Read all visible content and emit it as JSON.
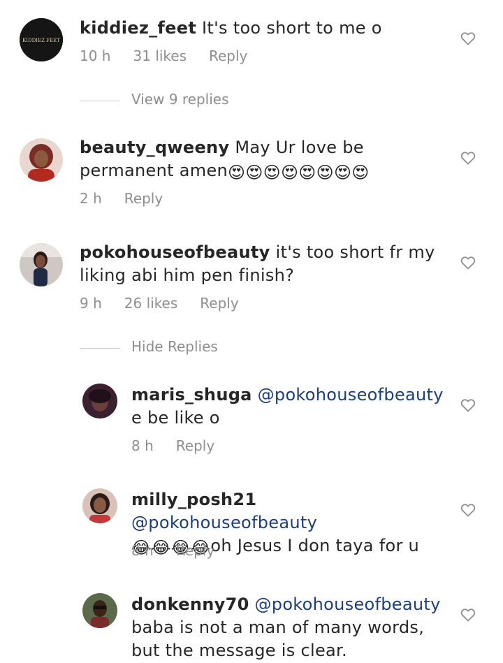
{
  "comments": [
    {
      "username": "kiddiez_feet",
      "text": " It's too short to me o",
      "time": "10 h",
      "likes": "31 likes",
      "reply": "Reply",
      "avatar_text": "KIDDIEZ FEET"
    },
    {
      "username": "beauty_qweeny",
      "text": " May Ur love be permanent amen",
      "emojis": "😍😍😍😍😍😍😍😍",
      "time": "2 h",
      "reply": "Reply"
    },
    {
      "username": "pokohouseofbeauty",
      "text": " it's too short fr my liking abi him pen finish?",
      "time": "9 h",
      "likes": "26 likes",
      "reply": "Reply"
    }
  ],
  "view_replies": "View 9 replies",
  "hide_replies": "Hide Replies",
  "replies": [
    {
      "username": "maris_shuga",
      "mention": " @pokohouseofbeauty",
      "text": " e be like o",
      "time": "8 h",
      "reply": "Reply"
    },
    {
      "username": "milly_posh21",
      "mention": " @pokohouseofbeauty",
      "emojis": "😂😂😂😂",
      "text": "oh Jesus I don taya for u",
      "time": "8 h",
      "reply": "Reply"
    },
    {
      "username": "donkenny70",
      "mention": " @pokohouseofbeauty",
      "text": " baba is not a man of many words, but the message is clear.",
      "time": "",
      "reply": ""
    }
  ],
  "colors": {
    "text": "#262626",
    "meta": "#8e8e8e",
    "mention": "#1c3f7a",
    "heart": "#8e8e8e"
  },
  "icons": [
    "heart-outline-icon"
  ]
}
